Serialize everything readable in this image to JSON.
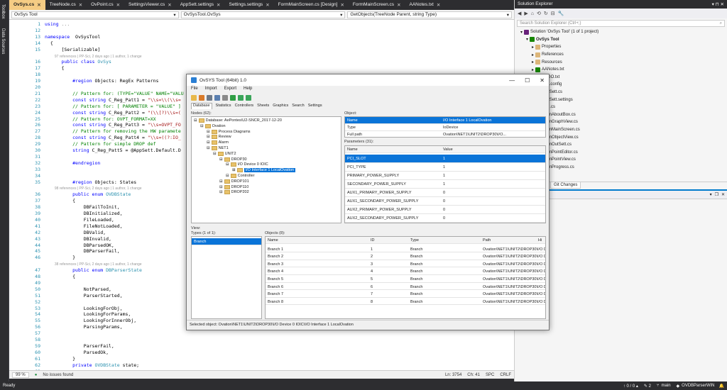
{
  "ide": {
    "leftbar": [
      "Toolbox",
      "Data Sources"
    ],
    "tabs": [
      {
        "label": "OvSys.cs",
        "active": true
      },
      {
        "label": "TreeNode.cs"
      },
      {
        "label": "OvPoint.cs"
      },
      {
        "label": "SettingsViewer.cs"
      },
      {
        "label": "AppSett.settings"
      },
      {
        "label": "Settings.settings"
      },
      {
        "label": "FormMainScreen.cs [Design]"
      },
      {
        "label": "FormMainScreen.cs"
      },
      {
        "label": "AANotes.txt"
      }
    ],
    "nav": {
      "project": "OvSys Tool",
      "class": "OvSysTool.OvSys",
      "member": "GetObjects(TreeNode Parent, string Type)"
    },
    "editor_status": {
      "zoom": "99 %",
      "issues": "No issues found",
      "position": "Ln: 3754",
      "col": "Ch: 41",
      "mode": "SPC",
      "eol": "CRLF"
    },
    "statusbar": {
      "ready": "Ready",
      "git": "↑ 0 / 0 ▴",
      "pencil": "✎ 2",
      "branch": "main",
      "repo": "OVDBParserWIN"
    }
  },
  "code": [
    {
      "n": "1",
      "t": [
        [
          "kw",
          "using"
        ],
        [
          "gr",
          " ..."
        ]
      ]
    },
    {
      "n": "12",
      "t": []
    },
    {
      "n": "13",
      "t": [
        [
          "kw",
          "namespace"
        ],
        [
          "",
          "  OvSysTool"
        ]
      ]
    },
    {
      "n": "14",
      "t": [
        [
          "",
          "  {"
        ]
      ]
    },
    {
      "n": "15",
      "t": [
        [
          "",
          "      [Serializable]"
        ]
      ]
    },
    {
      "n": "",
      "lens": "97 references | PP-Sci, 2 days ago | 1 author, 1 change"
    },
    {
      "n": "16",
      "t": [
        [
          "kw",
          "      public class "
        ],
        [
          "ty",
          "OvSys"
        ]
      ]
    },
    {
      "n": "17",
      "t": [
        [
          "",
          "      {"
        ]
      ]
    },
    {
      "n": "18",
      "t": []
    },
    {
      "n": "19",
      "t": [
        [
          "kw",
          "          #region"
        ],
        [
          "",
          " Objects: RegEx Patterns"
        ]
      ]
    },
    {
      "n": "20",
      "t": []
    },
    {
      "n": "21",
      "t": [
        [
          "cm",
          "          // Pattern for: (TYPE=\"VALUE\" NAME=\"VALU"
        ]
      ]
    },
    {
      "n": "22",
      "t": [
        [
          "kw",
          "          const string "
        ],
        [
          "",
          "C_Reg_Patt1 = "
        ],
        [
          "st",
          "\"\\\\s=\\\\(\\\\s="
        ]
      ]
    },
    {
      "n": "23",
      "t": [
        [
          "cm",
          "          // Pattern for: [ PARAMETER = \"VALUE\" ]"
        ]
      ]
    },
    {
      "n": "24",
      "t": [
        [
          "kw",
          "          const string "
        ],
        [
          "",
          "C_Reg_Patt2 = "
        ],
        [
          "st",
          "\"(\\\\[?)\\\\s=("
        ]
      ]
    },
    {
      "n": "25",
      "t": [
        [
          "cm",
          "          // Pattern for: OVPT_FORMAT=XX"
        ]
      ]
    },
    {
      "n": "26",
      "t": [
        [
          "kw",
          "          const string "
        ],
        [
          "",
          "C_Reg_Patt3 = "
        ],
        [
          "st",
          "\"\\\\s=OVPT_FO"
        ]
      ]
    },
    {
      "n": "27",
      "t": [
        [
          "cm",
          "          // Pattern for removing the HW paramete"
        ]
      ]
    },
    {
      "n": "28",
      "t": [
        [
          "kw",
          "          const string "
        ],
        [
          "",
          "C_Reg_Patt4 = "
        ],
        [
          "st",
          "\"\\\\s=((?:IO_"
        ]
      ]
    },
    {
      "n": "29",
      "t": [
        [
          "cm",
          "          // Pattern for simple DROP def"
        ]
      ]
    },
    {
      "n": "30",
      "t": [
        [
          "kw",
          "          string "
        ],
        [
          "",
          "C_Reg_Patt5 = @AppSett.Default.D"
        ]
      ]
    },
    {
      "n": "31",
      "t": []
    },
    {
      "n": "32",
      "t": [
        [
          "kw",
          "          #endregion"
        ]
      ]
    },
    {
      "n": "33",
      "t": []
    },
    {
      "n": "34",
      "t": []
    },
    {
      "n": "35",
      "t": [
        [
          "kw",
          "          #region"
        ],
        [
          "",
          " Objects: States"
        ]
      ]
    },
    {
      "n": "",
      "lens": "98 references | PP-Sci, 2 days ago | 1 author, 1 change"
    },
    {
      "n": "36",
      "t": [
        [
          "kw",
          "          public enum "
        ],
        [
          "ty",
          "OVDBState"
        ]
      ]
    },
    {
      "n": "37",
      "t": [
        [
          "",
          "          {"
        ]
      ]
    },
    {
      "n": "38",
      "t": [
        [
          "",
          "              DBFailToInit,"
        ]
      ]
    },
    {
      "n": "39",
      "t": [
        [
          "",
          "              DBInitialized,"
        ]
      ]
    },
    {
      "n": "40",
      "t": [
        [
          "",
          "              FileLoaded,"
        ]
      ]
    },
    {
      "n": "41",
      "t": [
        [
          "",
          "              FileNotLoaded,"
        ]
      ]
    },
    {
      "n": "42",
      "t": [
        [
          "",
          "              DBValid,"
        ]
      ]
    },
    {
      "n": "43",
      "t": [
        [
          "",
          "              DBInvalid,"
        ]
      ]
    },
    {
      "n": "44",
      "t": [
        [
          "",
          "              DBParsedOK,"
        ]
      ]
    },
    {
      "n": "45",
      "t": [
        [
          "",
          "              DBParserFail,"
        ]
      ]
    },
    {
      "n": "46",
      "t": [
        [
          "",
          "          }"
        ]
      ]
    },
    {
      "n": "",
      "lens": "38 references | PP-Sci, 2 days ago | 1 author, 1 change"
    },
    {
      "n": "47",
      "t": [
        [
          "kw",
          "          public enum "
        ],
        [
          "ty",
          "DBParserState"
        ]
      ]
    },
    {
      "n": "48",
      "t": [
        [
          "",
          "          {"
        ]
      ]
    },
    {
      "n": "49",
      "t": []
    },
    {
      "n": "50",
      "t": [
        [
          "",
          "              NotParsed,"
        ]
      ]
    },
    {
      "n": "51",
      "t": [
        [
          "",
          "              ParserStarted,"
        ]
      ]
    },
    {
      "n": "52",
      "t": []
    },
    {
      "n": "53",
      "t": [
        [
          "",
          "              LookingForObj,"
        ]
      ]
    },
    {
      "n": "54",
      "t": [
        [
          "",
          "              LookingForParams,"
        ]
      ]
    },
    {
      "n": "55",
      "t": [
        [
          "",
          "              LookingForInnerObj,"
        ]
      ]
    },
    {
      "n": "56",
      "t": [
        [
          "",
          "              ParsingParams,"
        ]
      ]
    },
    {
      "n": "57",
      "t": []
    },
    {
      "n": "58",
      "t": []
    },
    {
      "n": "59",
      "t": [
        [
          "",
          "              ParserFail,"
        ]
      ]
    },
    {
      "n": "60",
      "t": [
        [
          "",
          "              ParsedOk,"
        ]
      ]
    },
    {
      "n": "61",
      "t": [
        [
          "",
          "          }"
        ]
      ]
    },
    {
      "n": "62",
      "t": [
        [
          "kw",
          "          private "
        ],
        [
          "ty",
          "OVDBState"
        ],
        [
          "",
          " state;"
        ]
      ]
    },
    {
      "n": "63",
      "t": []
    }
  ],
  "solution": {
    "title": "Solution Explorer",
    "search": "Search Solution Explorer (Ctrl+;)",
    "items": [
      {
        "label": "Solution 'OvSys Tool' (1 of 1 project)",
        "indent": 0,
        "icon": "s"
      },
      {
        "label": "OvSys Tool",
        "indent": 1,
        "icon": "c",
        "bold": true
      },
      {
        "label": "Properties",
        "indent": 2,
        "icon": "f"
      },
      {
        "label": "References",
        "indent": 2,
        "icon": "f"
      },
      {
        "label": "Resources",
        "indent": 2,
        "icon": "f"
      },
      {
        "label": "AANotes.txt",
        "indent": 2,
        "icon": "c"
      },
      {
        "label": "TODO.txt",
        "indent": 2,
        "icon": "c"
      },
      {
        "label": "App.config",
        "indent": 2,
        "icon": "c"
      },
      {
        "label": "AppSett.cs",
        "indent": 2,
        "icon": "c"
      },
      {
        "label": "AppSett.settings",
        "indent": 2,
        "icon": "c"
      },
      {
        "label": "Msg.cs",
        "indent": 2,
        "icon": "c"
      },
      {
        "label": "FormAboutBox.cs",
        "indent": 2,
        "icon": "c"
      },
      {
        "label": "FormGraphView.cs",
        "indent": 2,
        "icon": "c"
      },
      {
        "label": "FormMainScreen.cs",
        "indent": 2,
        "icon": "c"
      },
      {
        "label": "FormObjectView.cs",
        "indent": 2,
        "icon": "c"
      },
      {
        "label": "FormOutSett.cs",
        "indent": 2,
        "icon": "c"
      },
      {
        "label": "FormPointEditor.cs",
        "indent": 2,
        "icon": "c"
      },
      {
        "label": "FormPointView.cs",
        "indent": 2,
        "icon": "c"
      },
      {
        "label": "FormProgress.cs",
        "indent": 2,
        "icon": "c"
      }
    ],
    "git_tab": "Git Changes"
  },
  "tool": {
    "title": "OvSYS Tool (64bit) 1.0",
    "menu": [
      "File",
      "Import",
      "Export",
      "Help"
    ],
    "tabs": [
      "Database",
      "Statistics",
      "Controllers",
      "Sheets",
      "Graphics",
      "Search",
      "Settings"
    ],
    "nodes_label": "Nodes (62):",
    "tree": [
      {
        "label": "Database: AePontes\\U2-SNCR_2017-12-20",
        "lvl": 0
      },
      {
        "label": "Ovation",
        "lvl": 1
      },
      {
        "label": "Process Diagrams",
        "lvl": 2
      },
      {
        "label": "Review",
        "lvl": 2
      },
      {
        "label": "Alarm",
        "lvl": 2
      },
      {
        "label": "NET1",
        "lvl": 2
      },
      {
        "label": "UNIT2",
        "lvl": 3
      },
      {
        "label": "DROP30",
        "lvl": 4
      },
      {
        "label": "I/O Device 0 IOIC",
        "lvl": 5
      },
      {
        "label": "I/O Interface 1 LocalOvation",
        "lvl": 6,
        "sel": true
      },
      {
        "label": "Controller",
        "lvl": 5
      },
      {
        "label": "DROP101",
        "lvl": 4
      },
      {
        "label": "DROP110",
        "lvl": 4
      },
      {
        "label": "DROP202",
        "lvl": 4
      }
    ],
    "object_label": "Object:",
    "object": [
      {
        "k": "Name",
        "v": "I/O Interface 1 LocalOvation",
        "sel": true
      },
      {
        "k": "Type",
        "v": "IoDevice"
      },
      {
        "k": "Full path",
        "v": "Ovation\\NET1\\UNIT2\\DROP30\\I/O..."
      }
    ],
    "params_label": "Parameters (31):",
    "params_header": [
      "Name",
      "Value"
    ],
    "params": [
      {
        "k": "PCI_SLOT",
        "v": "1",
        "sel": true
      },
      {
        "k": "PCI_TYPE",
        "v": "1"
      },
      {
        "k": "PRIMARY_POWER_SUPPLY",
        "v": "1"
      },
      {
        "k": "SECONDARY_POWER_SUPPLY",
        "v": "1"
      },
      {
        "k": "AUX1_PRIMARY_POWER_SUPPLY",
        "v": "0"
      },
      {
        "k": "AUX1_SECONDARY_POWER_SUPPLY",
        "v": "0"
      },
      {
        "k": "AUX2_PRIMARY_POWER_SUPPLY",
        "v": "0"
      },
      {
        "k": "AUX2_SECONDARY_POWER_SUPPLY",
        "v": "0"
      }
    ],
    "view_label": "View:",
    "types_label": "Types (1 of 1):",
    "types": [
      "Branch"
    ],
    "objects_label": "Objects (8):",
    "objects_header": [
      "Name",
      "ID",
      "Type",
      "Path",
      "Hi"
    ],
    "objects": [
      {
        "name": "Branch 1",
        "id": "1",
        "type": "Branch",
        "path": "Ovation\\NET1\\UNIT2\\DROP30\\I/O Device 0 I..."
      },
      {
        "name": "Branch 2",
        "id": "2",
        "type": "Branch",
        "path": "Ovation\\NET1\\UNIT2\\DROP30\\I/O Device 0 I..."
      },
      {
        "name": "Branch 3",
        "id": "3",
        "type": "Branch",
        "path": "Ovation\\NET1\\UNIT2\\DROP30\\I/O Device 0 I..."
      },
      {
        "name": "Branch 4",
        "id": "4",
        "type": "Branch",
        "path": "Ovation\\NET1\\UNIT2\\DROP30\\I/O Device 0 I..."
      },
      {
        "name": "Branch 5",
        "id": "5",
        "type": "Branch",
        "path": "Ovation\\NET1\\UNIT2\\DROP30\\I/O Device 0 I..."
      },
      {
        "name": "Branch 6",
        "id": "6",
        "type": "Branch",
        "path": "Ovation\\NET1\\UNIT2\\DROP30\\I/O Device 0 I..."
      },
      {
        "name": "Branch 7",
        "id": "7",
        "type": "Branch",
        "path": "Ovation\\NET1\\UNIT2\\DROP30\\I/O Device 0 I..."
      },
      {
        "name": "Branch 8",
        "id": "8",
        "type": "Branch",
        "path": "Ovation\\NET1\\UNIT2\\DROP30\\I/O Device 0 I..."
      }
    ],
    "status": "Selected object: Ovation\\NET1\\UNIT2\\DROP30\\I/O Device 0 IOIC\\I/O Interface 1 LocalOvation"
  }
}
